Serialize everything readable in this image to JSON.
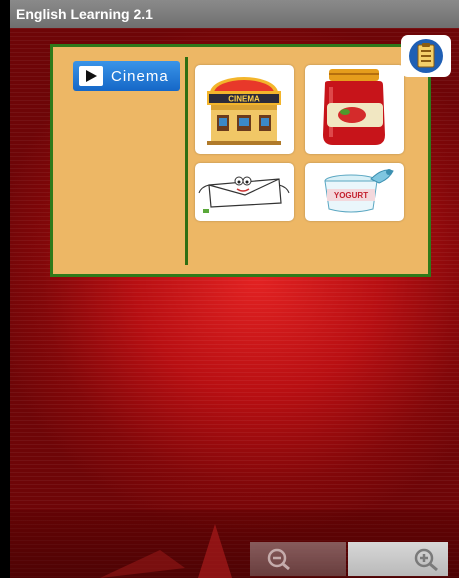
{
  "app": {
    "title": "English Learning 2.1"
  },
  "board": {
    "word_button": {
      "label": "Cinema",
      "icon": "play-icon"
    },
    "cards": [
      {
        "id": "cinema",
        "icon": "cinema-building-icon",
        "sign_text": "CINEMA"
      },
      {
        "id": "jam",
        "icon": "jam-jar-icon"
      },
      {
        "id": "envelope",
        "icon": "cartoon-envelope-icon"
      },
      {
        "id": "yogurt",
        "icon": "yogurt-cup-icon",
        "label_text": "YOGURT"
      }
    ]
  },
  "toolbar": {
    "notes_button": {
      "icon": "notes-list-icon"
    },
    "zoom_out": {
      "icon": "zoom-out-icon"
    },
    "zoom_in": {
      "icon": "zoom-in-icon"
    }
  },
  "colors": {
    "background": "#b80f12",
    "board": "#edb765",
    "board_border": "#2f7a1a",
    "word_button": "#1e78d6",
    "notes_icon": "#1f5fb4"
  }
}
